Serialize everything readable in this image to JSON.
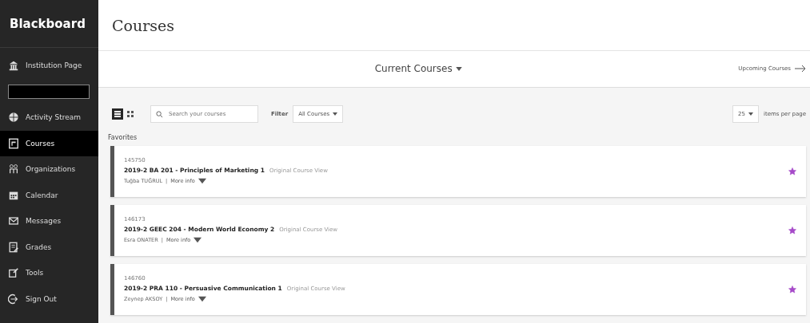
{
  "sidebar": {
    "logo": "Blackboard",
    "items": [
      {
        "kind": "link",
        "label": "Institution Page",
        "selected": false
      },
      {
        "kind": "redacted",
        "selected": false
      },
      {
        "kind": "link",
        "label": "Activity Stream",
        "selected": false
      },
      {
        "kind": "link",
        "label": "Courses",
        "selected": true
      },
      {
        "kind": "link",
        "label": "Organizations",
        "selected": false
      },
      {
        "kind": "link",
        "label": "Calendar",
        "selected": false
      },
      {
        "kind": "link",
        "label": "Messages",
        "selected": false
      },
      {
        "kind": "link",
        "label": "Grades",
        "selected": false
      },
      {
        "kind": "link",
        "label": "Tools",
        "selected": false
      },
      {
        "kind": "link",
        "label": "Sign Out",
        "selected": false
      }
    ]
  },
  "page_title": "Courses",
  "term_bar": {
    "current": "Current Courses",
    "next": "Upcoming Courses"
  },
  "toolbar": {
    "view_modes": [
      {
        "kind": "list",
        "selected": true
      },
      {
        "kind": "grid",
        "selected": false
      }
    ],
    "search": {
      "placeholder": "Search your courses"
    },
    "filter_label": "Filter",
    "filter_value": "All Courses",
    "per_page_value": "25",
    "per_page_label": "items per page"
  },
  "section_title": "Favorites",
  "courses": [
    {
      "id": "145750",
      "title": "2019-2 BA 201 - Principles of Marketing 1",
      "view": "Original Course View",
      "instructor": "Tuğba TUĞRUL",
      "separator": "|",
      "more": "More info",
      "favorite": true
    },
    {
      "id": "146173",
      "title": "2019-2 GEEC 204 - Modern World Economy 2",
      "view": "Original Course View",
      "instructor": "Esra ONATER",
      "separator": "|",
      "more": "More info",
      "favorite": true
    },
    {
      "id": "146760",
      "title": "2019-2 PRA 110 - Persuasive Communication 1",
      "view": "Original Course View",
      "instructor": "Zeynep AKSOY",
      "separator": "|",
      "more": "More info",
      "favorite": true
    }
  ]
}
